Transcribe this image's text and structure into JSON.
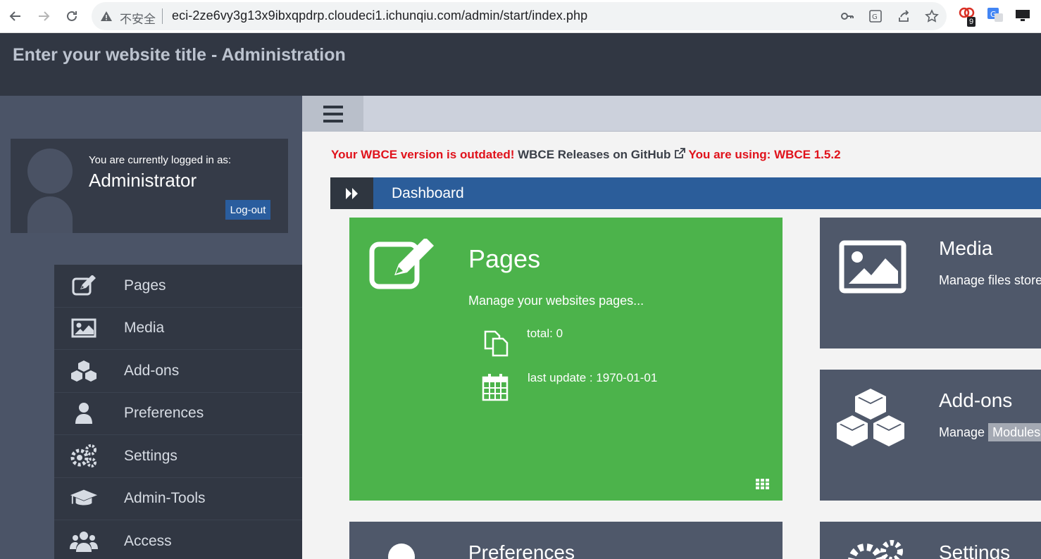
{
  "browser": {
    "insecure_label": "不安全",
    "url": "eci-2ze6vy3g13x9ibxqpdrp.cloudeci1.ichunqiu.com/admin/start/index.php",
    "extension_badge": "9"
  },
  "header": {
    "title": "Enter your website title - Administration"
  },
  "user": {
    "logged_in_label": "You are currently logged in as:",
    "name": "Administrator",
    "logout_label": "Log-out"
  },
  "sidebar": {
    "items": [
      {
        "label": "Pages",
        "icon": "edit-icon"
      },
      {
        "label": "Media",
        "icon": "image-icon"
      },
      {
        "label": "Add-ons",
        "icon": "cubes-icon"
      },
      {
        "label": "Preferences",
        "icon": "user-icon"
      },
      {
        "label": "Settings",
        "icon": "cogs-icon"
      },
      {
        "label": "Admin-Tools",
        "icon": "graduation-cap-icon"
      },
      {
        "label": "Access",
        "icon": "users-icon"
      }
    ]
  },
  "notice": {
    "outdated": "Your WBCE version is outdated!",
    "releases_link": "WBCE Releases on GitHub",
    "using": "You are using: WBCE 1.5.2"
  },
  "dashboard": {
    "title": "Dashboard"
  },
  "cards": {
    "pages": {
      "title": "Pages",
      "desc": "Manage your websites pages...",
      "total": "total: 0",
      "last_update": "last update : 1970-01-01"
    },
    "media": {
      "title": "Media",
      "desc": "Manage files store"
    },
    "addons": {
      "title": "Add-ons",
      "desc_prefix": "Manage",
      "desc_badge": "Modules"
    },
    "preferences": {
      "title": "Preferences"
    },
    "settings": {
      "title": "Settings"
    }
  },
  "colors": {
    "header_bg": "#313743",
    "sidebar_bg": "#4b5467",
    "menu_bg": "#313743",
    "accent_blue": "#2b5d9a",
    "card_green": "#4cb34b",
    "card_slate": "#4f586a",
    "warning_red": "#e0121b"
  }
}
